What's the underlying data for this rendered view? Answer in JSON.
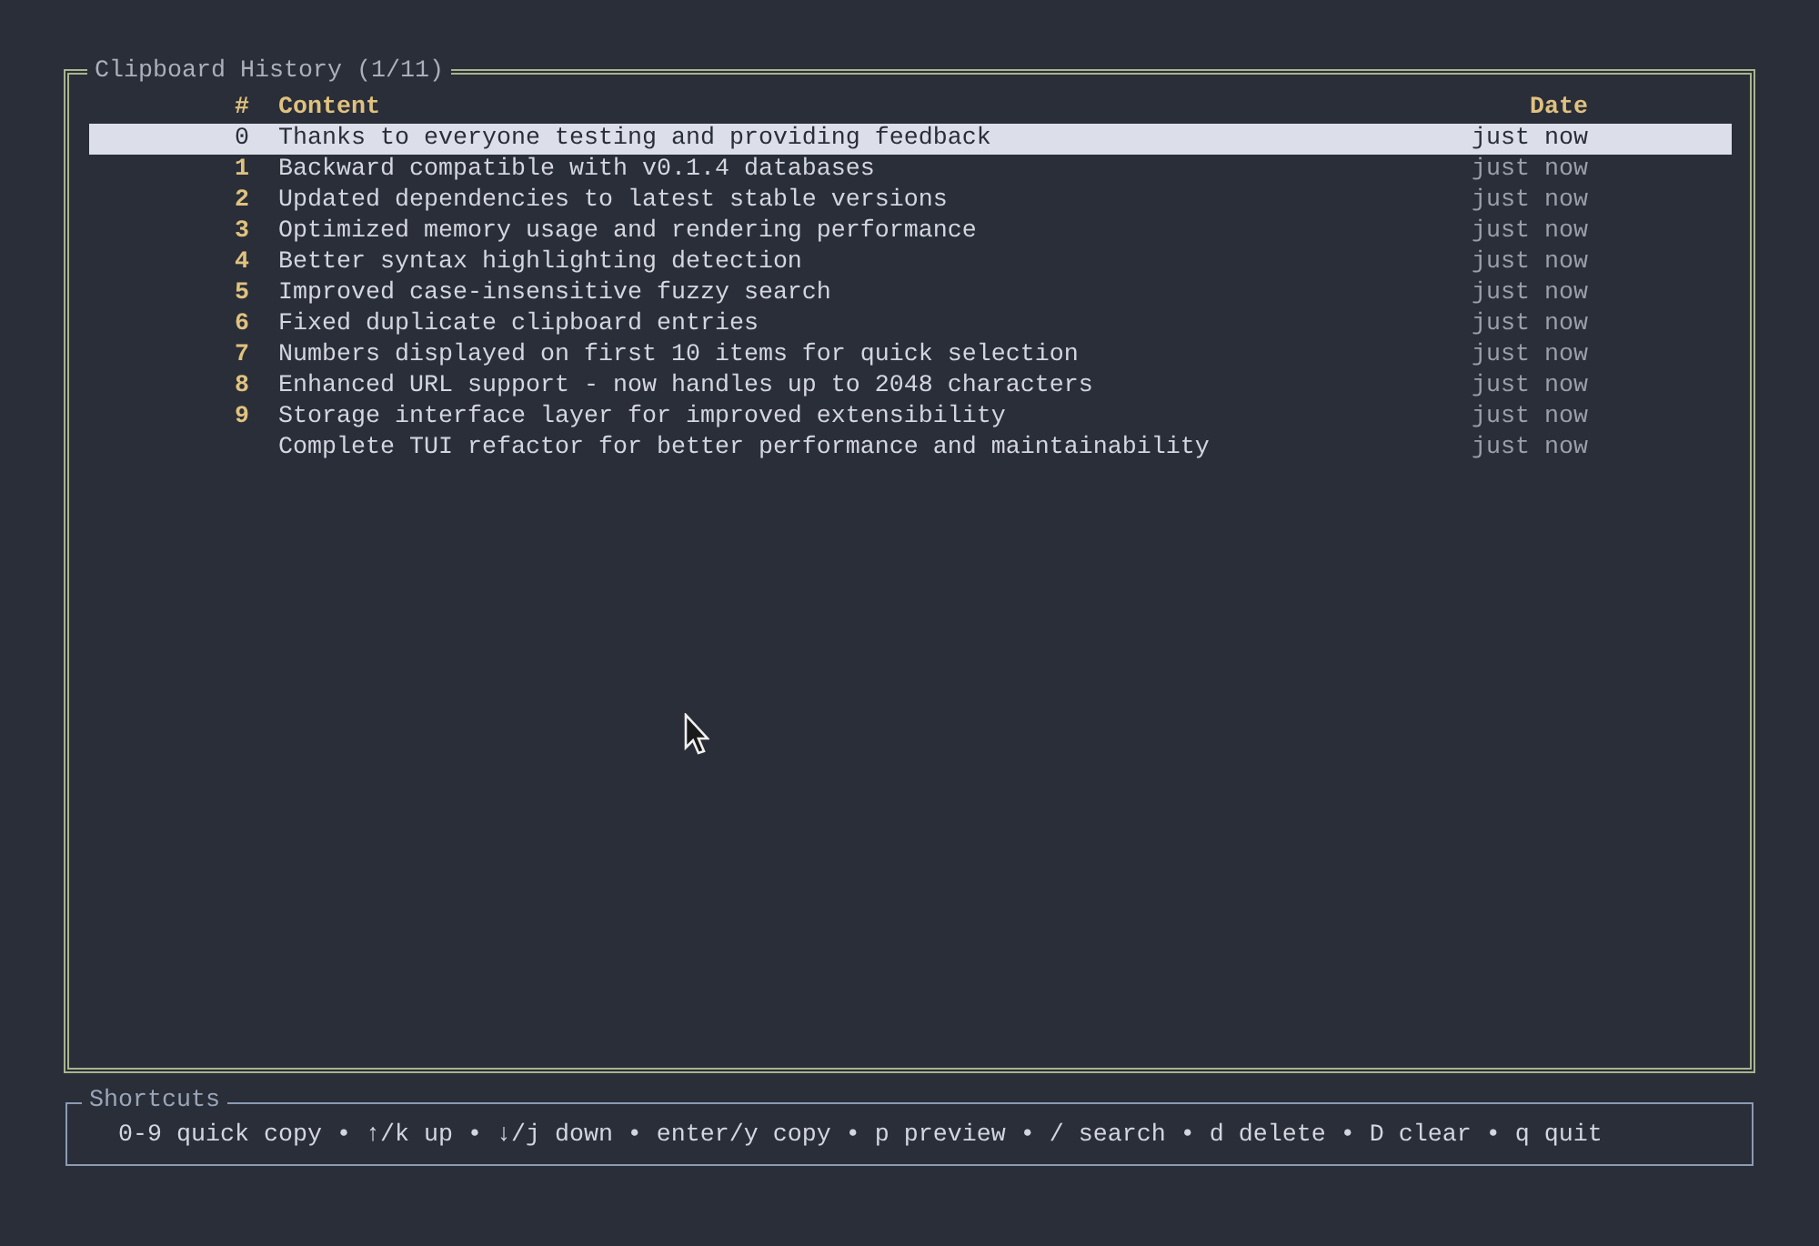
{
  "history": {
    "title": "Clipboard History (1/11)",
    "columns": [
      "#",
      "Content",
      "Date"
    ],
    "rows": [
      {
        "index": "0",
        "content": "Thanks to everyone testing and providing feedback",
        "date": "just now",
        "selected": true
      },
      {
        "index": "1",
        "content": "Backward compatible with v0.1.4 databases",
        "date": "just now",
        "selected": false
      },
      {
        "index": "2",
        "content": "Updated dependencies to latest stable versions",
        "date": "just now",
        "selected": false
      },
      {
        "index": "3",
        "content": "Optimized memory usage and rendering performance",
        "date": "just now",
        "selected": false
      },
      {
        "index": "4",
        "content": "Better syntax highlighting detection",
        "date": "just now",
        "selected": false
      },
      {
        "index": "5",
        "content": "Improved case-insensitive fuzzy search",
        "date": "just now",
        "selected": false
      },
      {
        "index": "6",
        "content": "Fixed duplicate clipboard entries",
        "date": "just now",
        "selected": false
      },
      {
        "index": "7",
        "content": "Numbers displayed on first 10 items for quick selection",
        "date": "just now",
        "selected": false
      },
      {
        "index": "8",
        "content": "Enhanced URL support - now handles up to 2048 characters",
        "date": "just now",
        "selected": false
      },
      {
        "index": "9",
        "content": "Storage interface layer for improved extensibility",
        "date": "just now",
        "selected": false
      },
      {
        "content": "Complete TUI refactor for better performance and maintainability",
        "date": "just now",
        "selected": false
      }
    ]
  },
  "shortcuts": {
    "title": "Shortcuts",
    "text": "0-9 quick copy • ↑/k up • ↓/j down • enter/y copy • p preview • / search • d delete • D clear • q quit"
  }
}
